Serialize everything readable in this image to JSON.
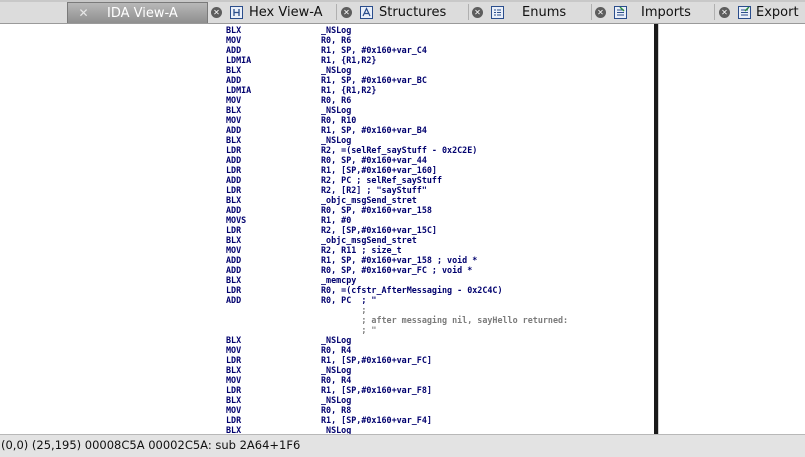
{
  "tabs": [
    {
      "label": "IDA View-A",
      "icon": "ida-view-icon",
      "active": true
    },
    {
      "label": "Hex View-A",
      "icon": "hex-view-icon",
      "active": false
    },
    {
      "label": "Structures",
      "icon": "structures-icon",
      "active": false
    },
    {
      "label": "Enums",
      "icon": "enums-icon",
      "active": false
    },
    {
      "label": "Imports",
      "icon": "imports-icon",
      "active": false
    },
    {
      "label": "Export",
      "icon": "exports-icon",
      "active": false
    }
  ],
  "listing": [
    {
      "mnemonic": "BLX",
      "operands": "_NSLog"
    },
    {
      "mnemonic": "MOV",
      "operands": "R0, R6"
    },
    {
      "mnemonic": "ADD",
      "operands": "R1, SP, #0x160+var_C4"
    },
    {
      "mnemonic": "LDMIA",
      "operands": "R1, {R1,R2}"
    },
    {
      "mnemonic": "BLX",
      "operands": "_NSLog"
    },
    {
      "mnemonic": "ADD",
      "operands": "R1, SP, #0x160+var_BC"
    },
    {
      "mnemonic": "LDMIA",
      "operands": "R1, {R1,R2}"
    },
    {
      "mnemonic": "MOV",
      "operands": "R0, R6"
    },
    {
      "mnemonic": "BLX",
      "operands": "_NSLog"
    },
    {
      "mnemonic": "MOV",
      "operands": "R0, R10"
    },
    {
      "mnemonic": "ADD",
      "operands": "R1, SP, #0x160+var_B4"
    },
    {
      "mnemonic": "BLX",
      "operands": "_NSLog"
    },
    {
      "mnemonic": "LDR",
      "operands": "R2, =(selRef_sayStuff - 0x2C2E)"
    },
    {
      "mnemonic": "ADD",
      "operands": "R0, SP, #0x160+var_44"
    },
    {
      "mnemonic": "LDR",
      "operands": "R1, [SP,#0x160+var_160]"
    },
    {
      "mnemonic": "ADD",
      "operands": "R2, PC ; selRef_sayStuff"
    },
    {
      "mnemonic": "LDR",
      "operands": "R2, [R2] ; \"sayStuff\""
    },
    {
      "mnemonic": "BLX",
      "operands": "_objc_msgSend_stret"
    },
    {
      "mnemonic": "ADD",
      "operands": "R0, SP, #0x160+var_158"
    },
    {
      "mnemonic": "MOVS",
      "operands": "R1, #0"
    },
    {
      "mnemonic": "LDR",
      "operands": "R2, [SP,#0x160+var_15C]"
    },
    {
      "mnemonic": "BLX",
      "operands": "_objc_msgSend_stret"
    },
    {
      "mnemonic": "MOV",
      "operands": "R2, R11 ; size_t"
    },
    {
      "mnemonic": "ADD",
      "operands": "R1, SP, #0x160+var_158 ; void *"
    },
    {
      "mnemonic": "ADD",
      "operands": "R0, SP, #0x160+var_FC ; void *"
    },
    {
      "mnemonic": "BLX",
      "operands": "_memcpy"
    },
    {
      "mnemonic": "LDR",
      "operands": "R0, =(cfstr_AfterMessaging - 0x2C4C)"
    },
    {
      "mnemonic": "ADD",
      "operands": "R0, PC  ; \""
    },
    {
      "mnemonic": "",
      "operands": "        ;"
    },
    {
      "mnemonic": "",
      "operands": "        ; after messaging nil, sayHello returned:"
    },
    {
      "mnemonic": "",
      "operands": "        ; \""
    },
    {
      "mnemonic": "BLX",
      "operands": "_NSLog"
    },
    {
      "mnemonic": "MOV",
      "operands": "R0, R4"
    },
    {
      "mnemonic": "LDR",
      "operands": "R1, [SP,#0x160+var_FC]"
    },
    {
      "mnemonic": "BLX",
      "operands": "_NSLog"
    },
    {
      "mnemonic": "MOV",
      "operands": "R0, R4"
    },
    {
      "mnemonic": "LDR",
      "operands": "R1, [SP,#0x160+var_F8]"
    },
    {
      "mnemonic": "BLX",
      "operands": "_NSLog"
    },
    {
      "mnemonic": "MOV",
      "operands": "R0, R8"
    },
    {
      "mnemonic": "LDR",
      "operands": "R1, [SP,#0x160+var_F4]"
    },
    {
      "mnemonic": "BLX",
      "operands": "_NSLog"
    }
  ],
  "status": {
    "text": "(0,0) (25,195) 00008C5A 00002C5A: sub 2A64+1F6"
  },
  "colors": {
    "mnemonic": "#00006e",
    "comment": "#7b7b7b",
    "symbol": "#2626c8",
    "active_tab": "#9c9c9c"
  }
}
